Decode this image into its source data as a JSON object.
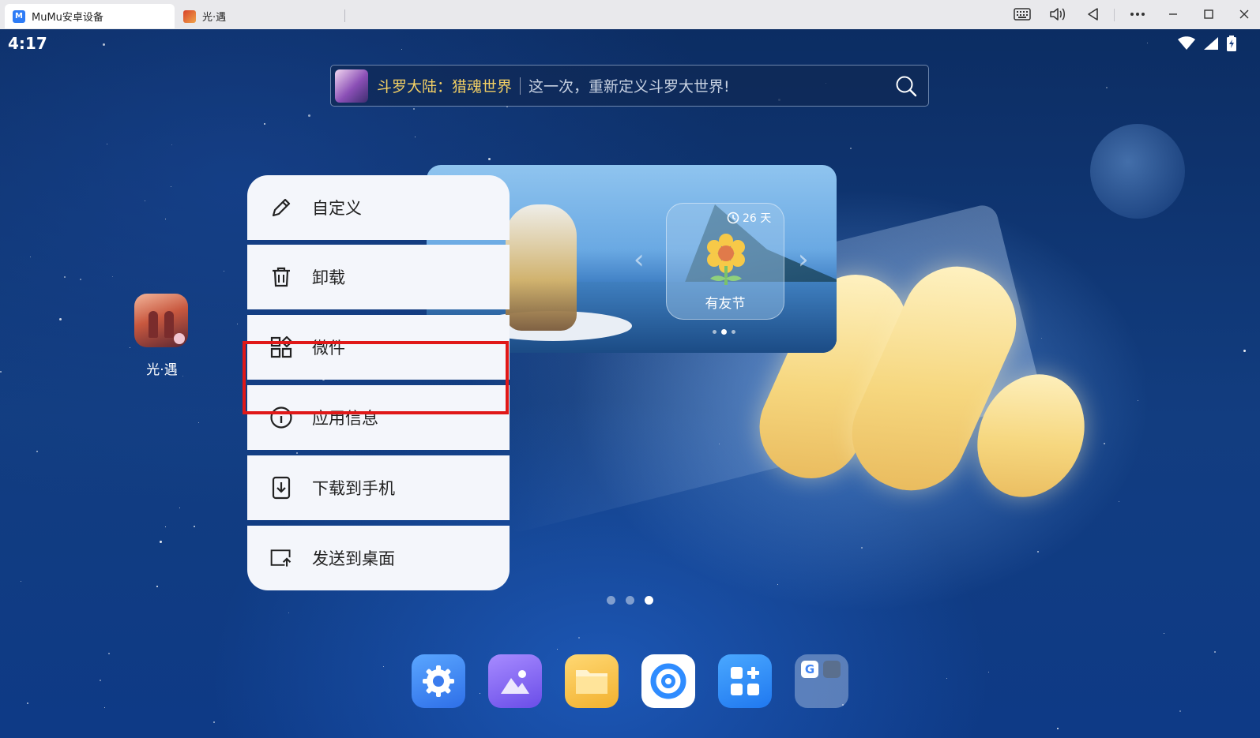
{
  "window": {
    "tabs": [
      {
        "label": "MuMu安卓设备",
        "icon": "mumu-logo-icon"
      },
      {
        "label": "光·遇",
        "icon": "sky-game-icon"
      }
    ],
    "controls": [
      "keyboard-icon",
      "volume-icon",
      "back-icon",
      "more-icon",
      "minimize-icon",
      "maximize-icon",
      "close-icon"
    ]
  },
  "status_bar": {
    "time": "4:17",
    "icons": [
      "wifi-icon",
      "signal-icon",
      "battery-charging-icon"
    ]
  },
  "search": {
    "game_title": "斗罗大陆：猎魂世界",
    "slogan": "这一次，重新定义斗罗大世界!",
    "icon": "search-icon"
  },
  "banner": {
    "event_days": "26 天",
    "event_name": "有友节",
    "page_count": 3,
    "current_page": 2
  },
  "desktop_app": {
    "label": "光·遇"
  },
  "context_menu": {
    "items": [
      {
        "label": "自定义",
        "icon": "pencil-icon"
      },
      {
        "label": "卸载",
        "icon": "trash-icon"
      },
      {
        "label": "微件",
        "icon": "widgets-icon"
      },
      {
        "label": "应用信息",
        "icon": "info-icon"
      },
      {
        "label": "下载到手机",
        "icon": "download-to-phone-icon"
      },
      {
        "label": "发送到桌面",
        "icon": "send-to-desktop-icon"
      }
    ],
    "highlighted": "微件",
    "highlight_color": "#e01818"
  },
  "home": {
    "page_count": 3,
    "current_page": 3
  },
  "dock": {
    "apps": [
      "settings-icon",
      "gallery-icon",
      "files-icon",
      "browser-icon",
      "app-store-icon",
      "google-folder-icon"
    ]
  }
}
